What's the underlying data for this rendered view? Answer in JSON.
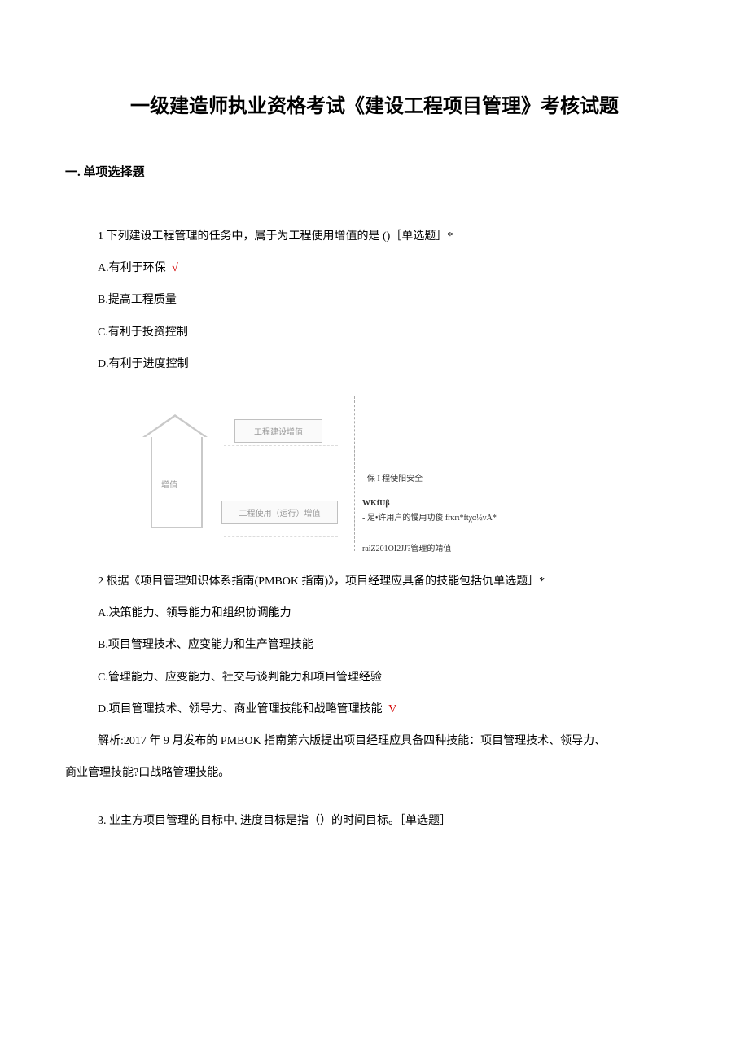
{
  "title": "一级建造师执业资格考试《建设工程项目管理》考核试题",
  "section": "一. 单项选择题",
  "q1": {
    "text": "1 下列建设工程管理的任务中，属于为工程使用增值的是 ()［单选题］*",
    "optA": "A.有利于环保",
    "optB": "B.提高工程质量",
    "optC": "C.有利于投资控制",
    "optD": "D.有利于进度控制",
    "check": "√"
  },
  "diagram": {
    "arrowLabel": "增值",
    "box1": "工程建设增值",
    "box2": "工程使用（运行）增值",
    "note1": "- 保 I 程使阳安全",
    "note2a": "WKfUβ",
    "note2b": "- 足•许用户的慢用功俊 frκrι*ftχα½vA*",
    "note3": "raiZ201OI2JJ?管理的靖值"
  },
  "q2": {
    "text": "2 根据《项目管理知识体系指南(PMBOK 指南)》，项目经理应具备的技能包括仇单选题］*",
    "optA": "A.决策能力、领导能力和组织协调能力",
    "optB": "B.项目管理技术、应变能力和生产管理技能",
    "optC": "C.管理能力、应变能力、社交与谈判能力和项目管理经验",
    "optD": "D.项目管理技术、领导力、商业管理技能和战略管理技能",
    "check": "V",
    "analysis": "解析:2017 年 9 月发布的 PMBOK 指南第六版提出项目经理应具备四种技能：项目管理技术、领导力、",
    "analysis2": "商业管理技能?口战略管理技能。"
  },
  "q3": {
    "text": "3. 业主方项目管理的目标中, 进度目标是指（）的时间目标。［单选题］"
  }
}
